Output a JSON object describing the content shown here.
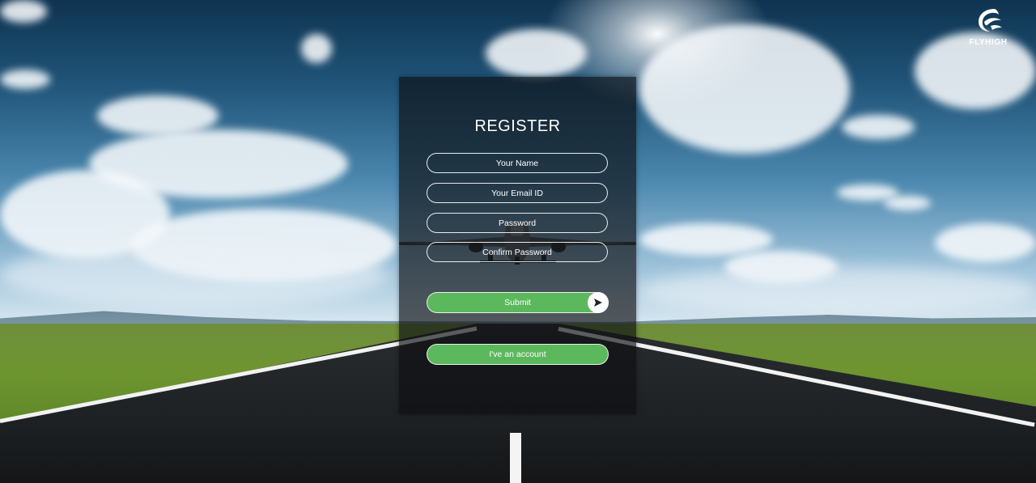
{
  "brand": {
    "name": "FLYHIGH",
    "icon": "bird-logo-icon"
  },
  "form": {
    "title": "REGISTER",
    "name_placeholder": "Your Name",
    "email_placeholder": "Your Email ID",
    "password_placeholder": "Password",
    "confirm_placeholder": "Confirm Password",
    "submit_label": "Submit",
    "submit_icon": "send-arrow-icon",
    "account_label": "I've an account"
  },
  "colors": {
    "button_green": "#5cb85c",
    "panel_overlay": "rgba(12,14,16,0.66)",
    "text": "#ffffff"
  }
}
